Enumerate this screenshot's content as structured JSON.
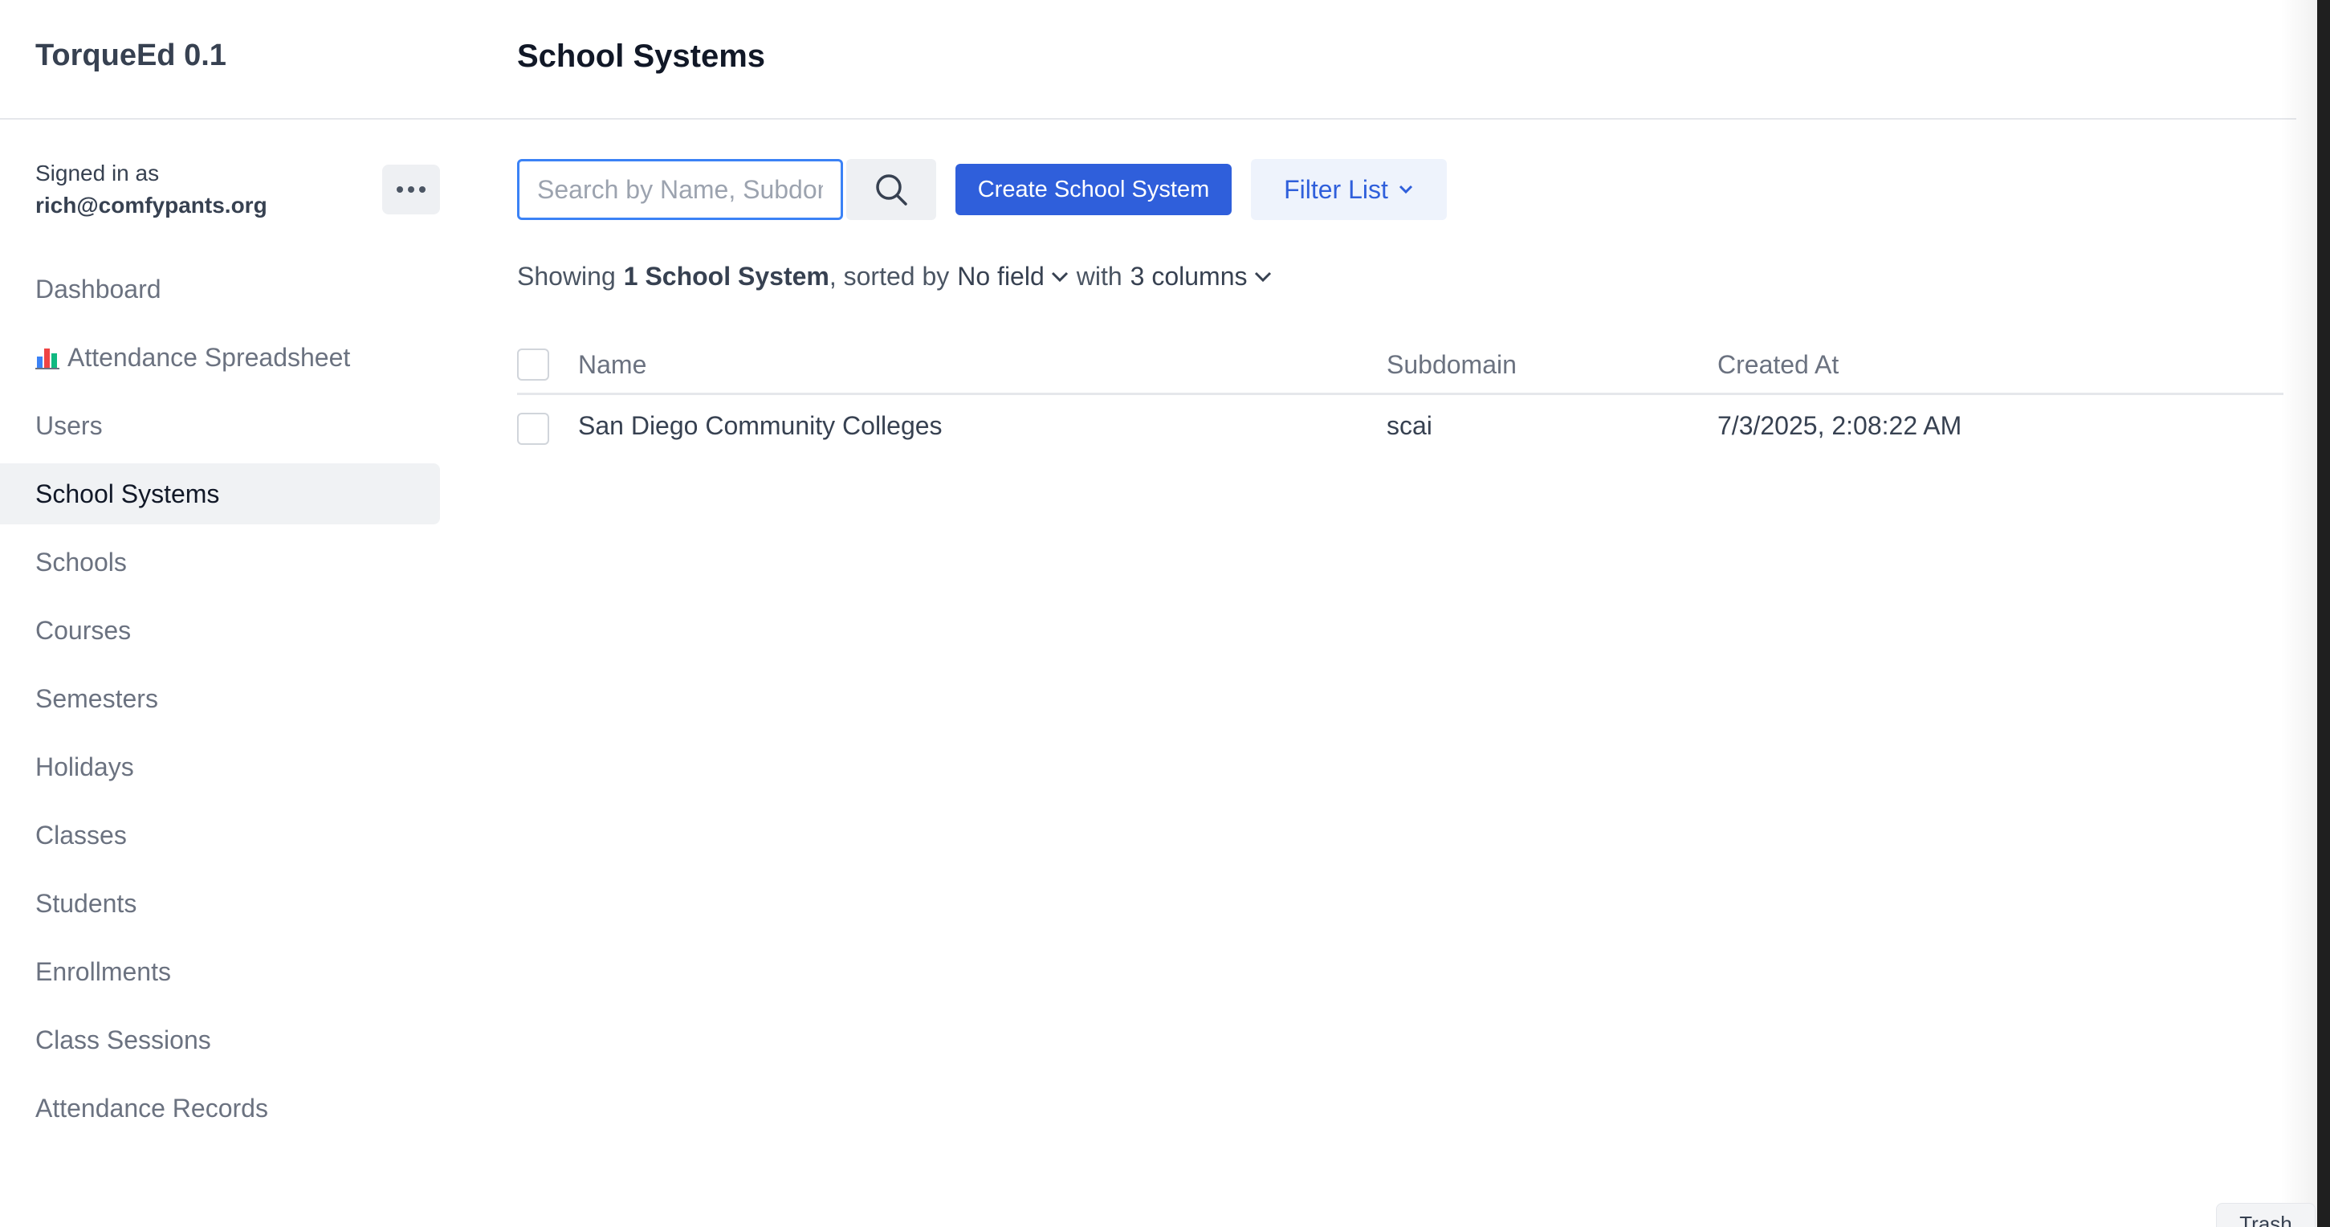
{
  "header": {
    "app_title": "TorqueEd 0.1",
    "page_title": "School Systems"
  },
  "user": {
    "signed_in_label": "Signed in as",
    "email": "rich@comfypants.org",
    "menu_icon": "more-horizontal-icon"
  },
  "sidebar": {
    "items": [
      {
        "label": "Dashboard",
        "active": false
      },
      {
        "label": "Attendance Spreadsheet",
        "icon": "bar-chart-icon",
        "active": false
      },
      {
        "label": "Users",
        "active": false
      },
      {
        "label": "School Systems",
        "active": true
      },
      {
        "label": "Schools",
        "active": false
      },
      {
        "label": "Courses",
        "active": false
      },
      {
        "label": "Semesters",
        "active": false
      },
      {
        "label": "Holidays",
        "active": false
      },
      {
        "label": "Classes",
        "active": false
      },
      {
        "label": "Students",
        "active": false
      },
      {
        "label": "Enrollments",
        "active": false
      },
      {
        "label": "Class Sessions",
        "active": false
      },
      {
        "label": "Attendance Records",
        "active": false
      }
    ]
  },
  "toolbar": {
    "search_placeholder": "Search by Name, Subdomain",
    "search_value": "",
    "search_icon": "search-icon",
    "create_label": "Create School System",
    "filter_label": "Filter List"
  },
  "summary": {
    "prefix": "Showing",
    "count_text": "1 School System",
    "sorted_by": ", sorted by",
    "sort_field": "No field",
    "with": "with",
    "columns_text": "3 columns"
  },
  "table": {
    "columns": [
      "Name",
      "Subdomain",
      "Created At"
    ],
    "rows": [
      {
        "name": "San Diego Community Colleges",
        "subdomain": "scai",
        "created_at": "7/3/2025, 2:08:22 AM"
      }
    ]
  },
  "footer": {
    "trash_label": "Trash"
  },
  "colors": {
    "primary": "#2f5fdb",
    "focus": "#3b82f6",
    "active_nav_bg": "#f0f2f4"
  }
}
